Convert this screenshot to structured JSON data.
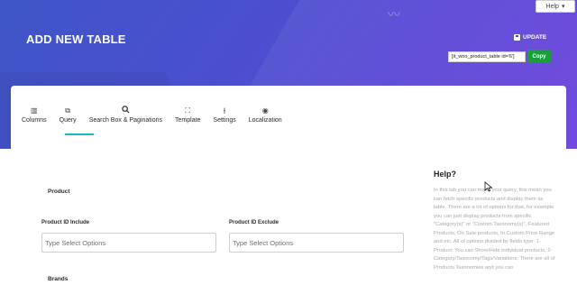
{
  "header": {
    "help_button": "Help",
    "title": "ADD NEW TABLE",
    "update_label": "UPDATE",
    "shortcode": "[it_woo_product_table id='6']",
    "copy_label": "Copy"
  },
  "tabs": [
    {
      "label": "Columns",
      "icon": "columns-icon"
    },
    {
      "label": "Query",
      "icon": "query-icon",
      "active": true
    },
    {
      "label": "Search Box & Paginations",
      "icon": "search-icon"
    },
    {
      "label": "Template",
      "icon": "template-icon"
    },
    {
      "label": "Settings",
      "icon": "sliders-icon"
    },
    {
      "label": "Localization",
      "icon": "target-icon"
    }
  ],
  "form": {
    "product_section": "Product",
    "include_label": "Product ID Include",
    "include_placeholder": "Type Select Options",
    "exclude_label": "Product ID Exclude",
    "exclude_placeholder": "Type Select Options",
    "brands_section": "Brands"
  },
  "help": {
    "title": "Help?",
    "body": "In this tab you can make your query, this mean you can fetch specific products and display them as table. There are a lot of options for that, for example you can just display products from specific \"Category(s)\" or \"Custom Taxonomy(s)\", Featured Products, On Sale products, In Custom Price Range and etc. All of options divided by fields type: 1- Product: You can Show/Hide individual products, 2- Category/Taxonomy/Tags/Variations: There are all of Products Taxonomies and you can"
  },
  "colors": {
    "banner_start": "#3f56c7",
    "banner_end": "#6a3fdc",
    "copy_button": "#1a9d3b",
    "active_tab_underline": "#1fb7c8"
  }
}
